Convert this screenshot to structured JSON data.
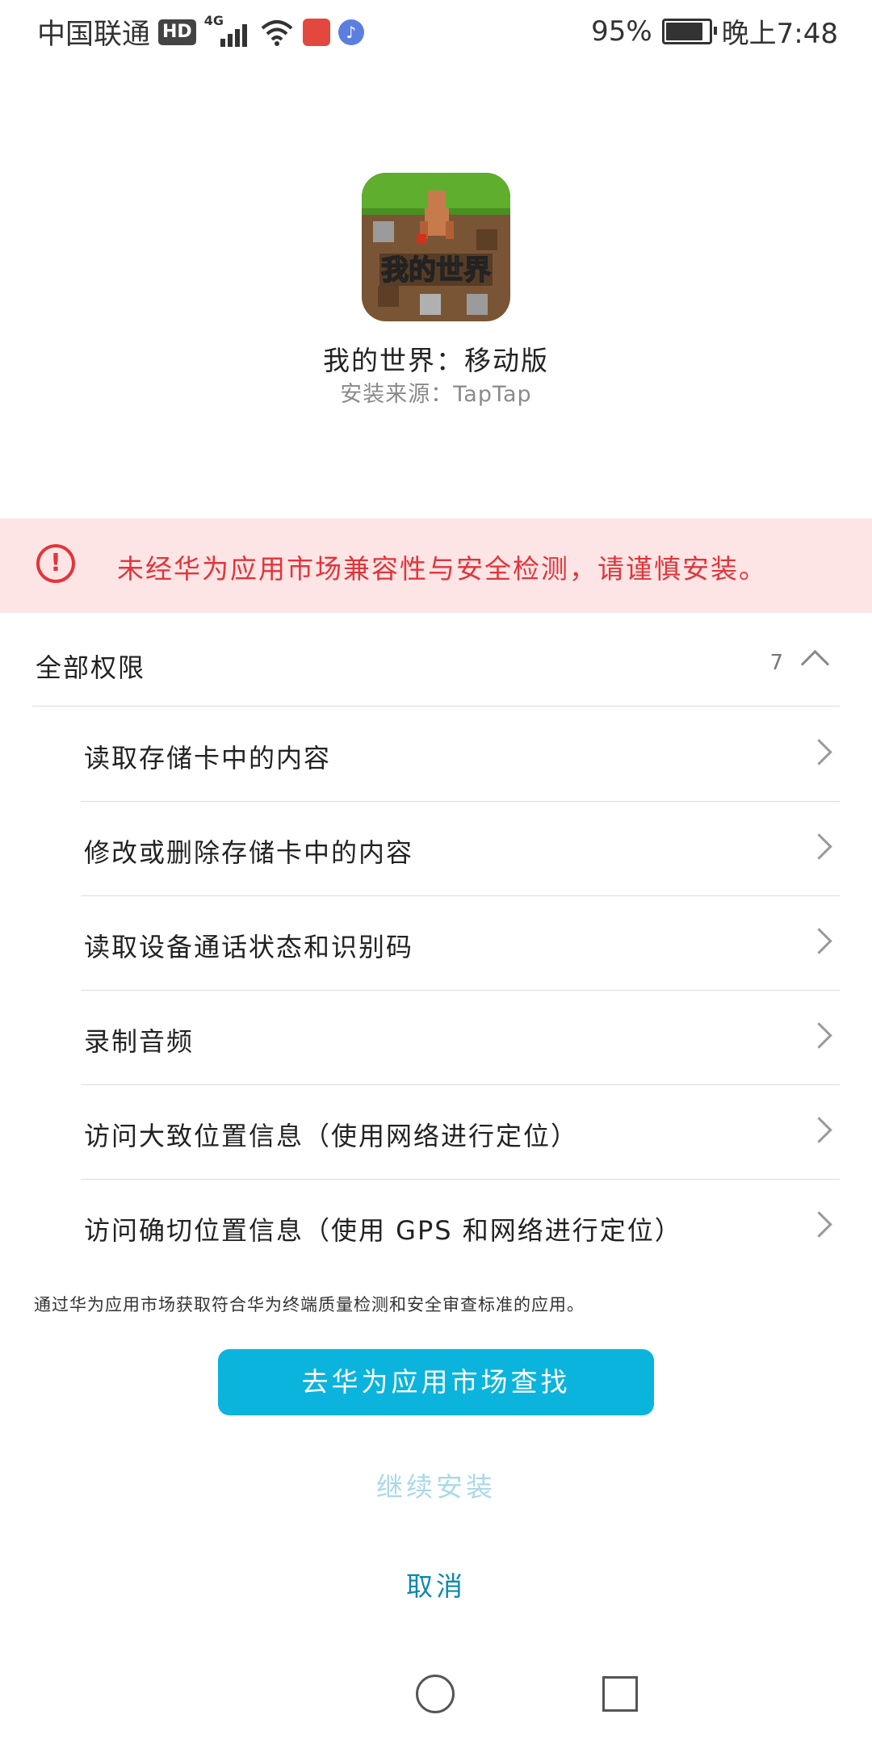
{
  "status_bar": {
    "carrier": "中国联通",
    "hd": "HD",
    "network": "4G",
    "battery": "95%",
    "battery_level": 0.95,
    "time": "晚上7:48"
  },
  "app": {
    "name": "我的世界：移动版",
    "source": "安装来源：TapTap",
    "icon_text": "我的世界"
  },
  "warning": {
    "icon": "exclamation-circle-icon",
    "text": "未经华为应用市场兼容性与安全检测，请谨慎安装。",
    "color": "#e2353a",
    "background": "#fde5e6"
  },
  "permissions": {
    "title": "全部权限",
    "count": "7",
    "items": [
      {
        "label": "读取存储卡中的内容"
      },
      {
        "label": "修改或删除存储卡中的内容"
      },
      {
        "label": "读取设备通话状态和识别码"
      },
      {
        "label": "录制音频"
      },
      {
        "label": "访问大致位置信息（使用网络进行定位）"
      },
      {
        "label": "访问确切位置信息（使用 GPS 和网络进行定位）"
      }
    ]
  },
  "footer_note": "通过华为应用市场获取符合华为终端质量检测和安全审查标准的应用。",
  "buttons": {
    "primary": "去华为应用市场查找",
    "continue": "继续安装",
    "cancel": "取消"
  },
  "colors": {
    "primary_button": "#0ab4dc",
    "cancel_text": "#0b8aab"
  }
}
